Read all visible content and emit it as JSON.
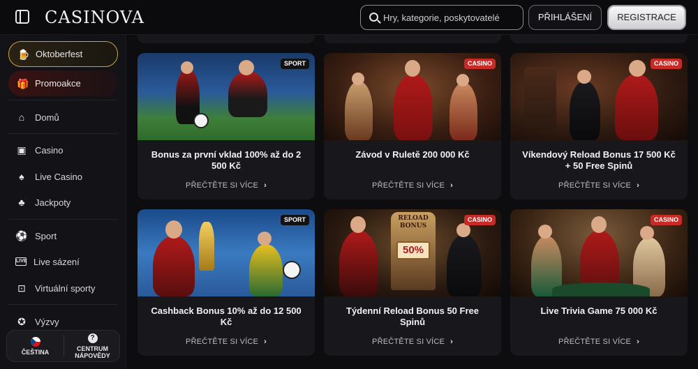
{
  "header": {
    "logo": "CASINOVA",
    "search_placeholder": "Hry, kategorie, poskytovatelé",
    "login_label": "PŘIHLÁŠENÍ",
    "register_label": "REGISTRACE"
  },
  "sidebar": {
    "promos": [
      {
        "label": "Oktoberfest",
        "icon": "beer-mug-icon"
      },
      {
        "label": "Promoakce",
        "icon": "gift-icon"
      }
    ],
    "items": [
      {
        "label": "Domů",
        "icon": "home-icon"
      },
      {
        "label": "Casino",
        "icon": "slot-machine-icon"
      },
      {
        "label": "Live Casino",
        "icon": "live-casino-icon"
      },
      {
        "label": "Jackpoty",
        "icon": "clover-icon"
      },
      {
        "label": "Sport",
        "icon": "soccer-ball-icon"
      },
      {
        "label": "Live sázení",
        "icon": "live-icon"
      },
      {
        "label": "Virtuální sporty",
        "icon": "virtual-sport-icon"
      },
      {
        "label": "Výzvy",
        "icon": "challenge-icon"
      }
    ],
    "language_label": "ČEŠTINA",
    "help_label_1": "CENTRUM",
    "help_label_2": "NÁPOVĚDY",
    "help_icon_glyph": "?"
  },
  "promotions": [
    {
      "badge": "SPORT",
      "title": "Bonus za první vklad 100% až do 2 500 Kč",
      "more": "PŘEČTĚTE SI VÍCE"
    },
    {
      "badge": "CASINO",
      "title": "Závod v Ruletě 200 000 Kč",
      "more": "PŘEČTĚTE SI VÍCE"
    },
    {
      "badge": "CASINO",
      "title": "Víkendový Reload Bonus 17 500 Kč + 50 Free Spinů",
      "more": "PŘEČTĚTE SI VÍCE"
    },
    {
      "badge": "SPORT",
      "title": "Cashback Bonus 10% až do 12 500 Kč",
      "more": "PŘEČTĚTE SI VÍCE"
    },
    {
      "badge": "CASINO",
      "title": "Týdenní Reload Bonus 50 Free Spinů",
      "more": "PŘEČTĚTE SI VÍCE"
    },
    {
      "badge": "CASINO",
      "title": "Live Trivia Game 75 000 Kč",
      "more": "PŘEČTĚTE SI VÍCE"
    }
  ],
  "image_text": {
    "reload_sign": "RELOAD BONUS",
    "reel_value": "50%"
  },
  "colors": {
    "accent_gold": "#c9a14a",
    "casino_badge": "#c82a26",
    "background": "#0d0d10"
  }
}
